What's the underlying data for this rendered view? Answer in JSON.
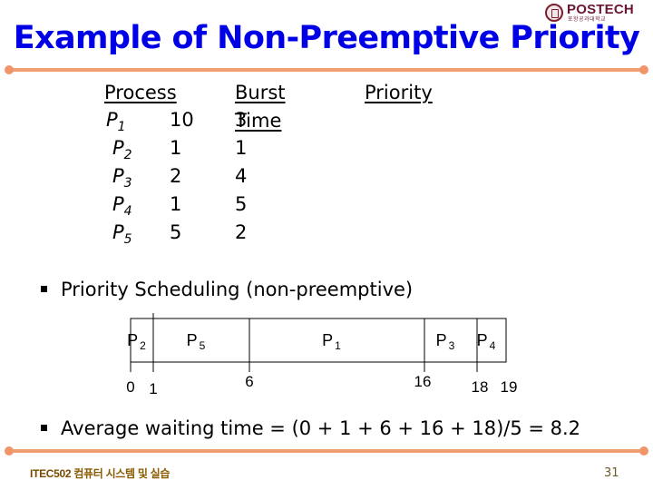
{
  "logo": {
    "name": "POSTECH",
    "subtitle": "포항공과대학교",
    "colors": {
      "brand": "#6a1630"
    }
  },
  "slide": {
    "title": "Example of Non-Preemptive Priority",
    "title_color": "#0000e6",
    "rule_color": "#f0a070"
  },
  "process_table": {
    "headers": [
      "Process",
      "Burst Time",
      "Priority"
    ],
    "rows": [
      {
        "process": "P",
        "sub": "1",
        "burst_time": "10",
        "priority": "3"
      },
      {
        "process": "P",
        "sub": "2",
        "burst_time": "1",
        "priority": "1"
      },
      {
        "process": "P",
        "sub": "3",
        "burst_time": "2",
        "priority": "4"
      },
      {
        "process": "P",
        "sub": "4",
        "burst_time": "1",
        "priority": "5"
      },
      {
        "process": "P",
        "sub": "5",
        "burst_time": "5",
        "priority": "2"
      }
    ]
  },
  "bullets": [
    "Priority Scheduling (non-preemptive)",
    "Average waiting time = (0 + 1 + 6 + 16 + 18)/5  = 8.2"
  ],
  "chart_data": {
    "type": "gantt",
    "title": "",
    "segments": [
      {
        "name": "P",
        "sub": "2",
        "start": 0,
        "end": 1
      },
      {
        "name": "P",
        "sub": "5",
        "start": 1,
        "end": 6
      },
      {
        "name": "P",
        "sub": "1",
        "start": 6,
        "end": 16
      },
      {
        "name": "P",
        "sub": "3",
        "start": 16,
        "end": 18
      },
      {
        "name": "P",
        "sub": "4",
        "start": 18,
        "end": 19
      }
    ],
    "tick_labels": [
      "0",
      "1",
      "6",
      "16",
      "18",
      "19"
    ],
    "xlim": [
      0,
      19
    ]
  },
  "footer": {
    "course_code": "ITEC502",
    "course_name": "컴퓨터 시스템 및 실습",
    "page_number": "31"
  }
}
